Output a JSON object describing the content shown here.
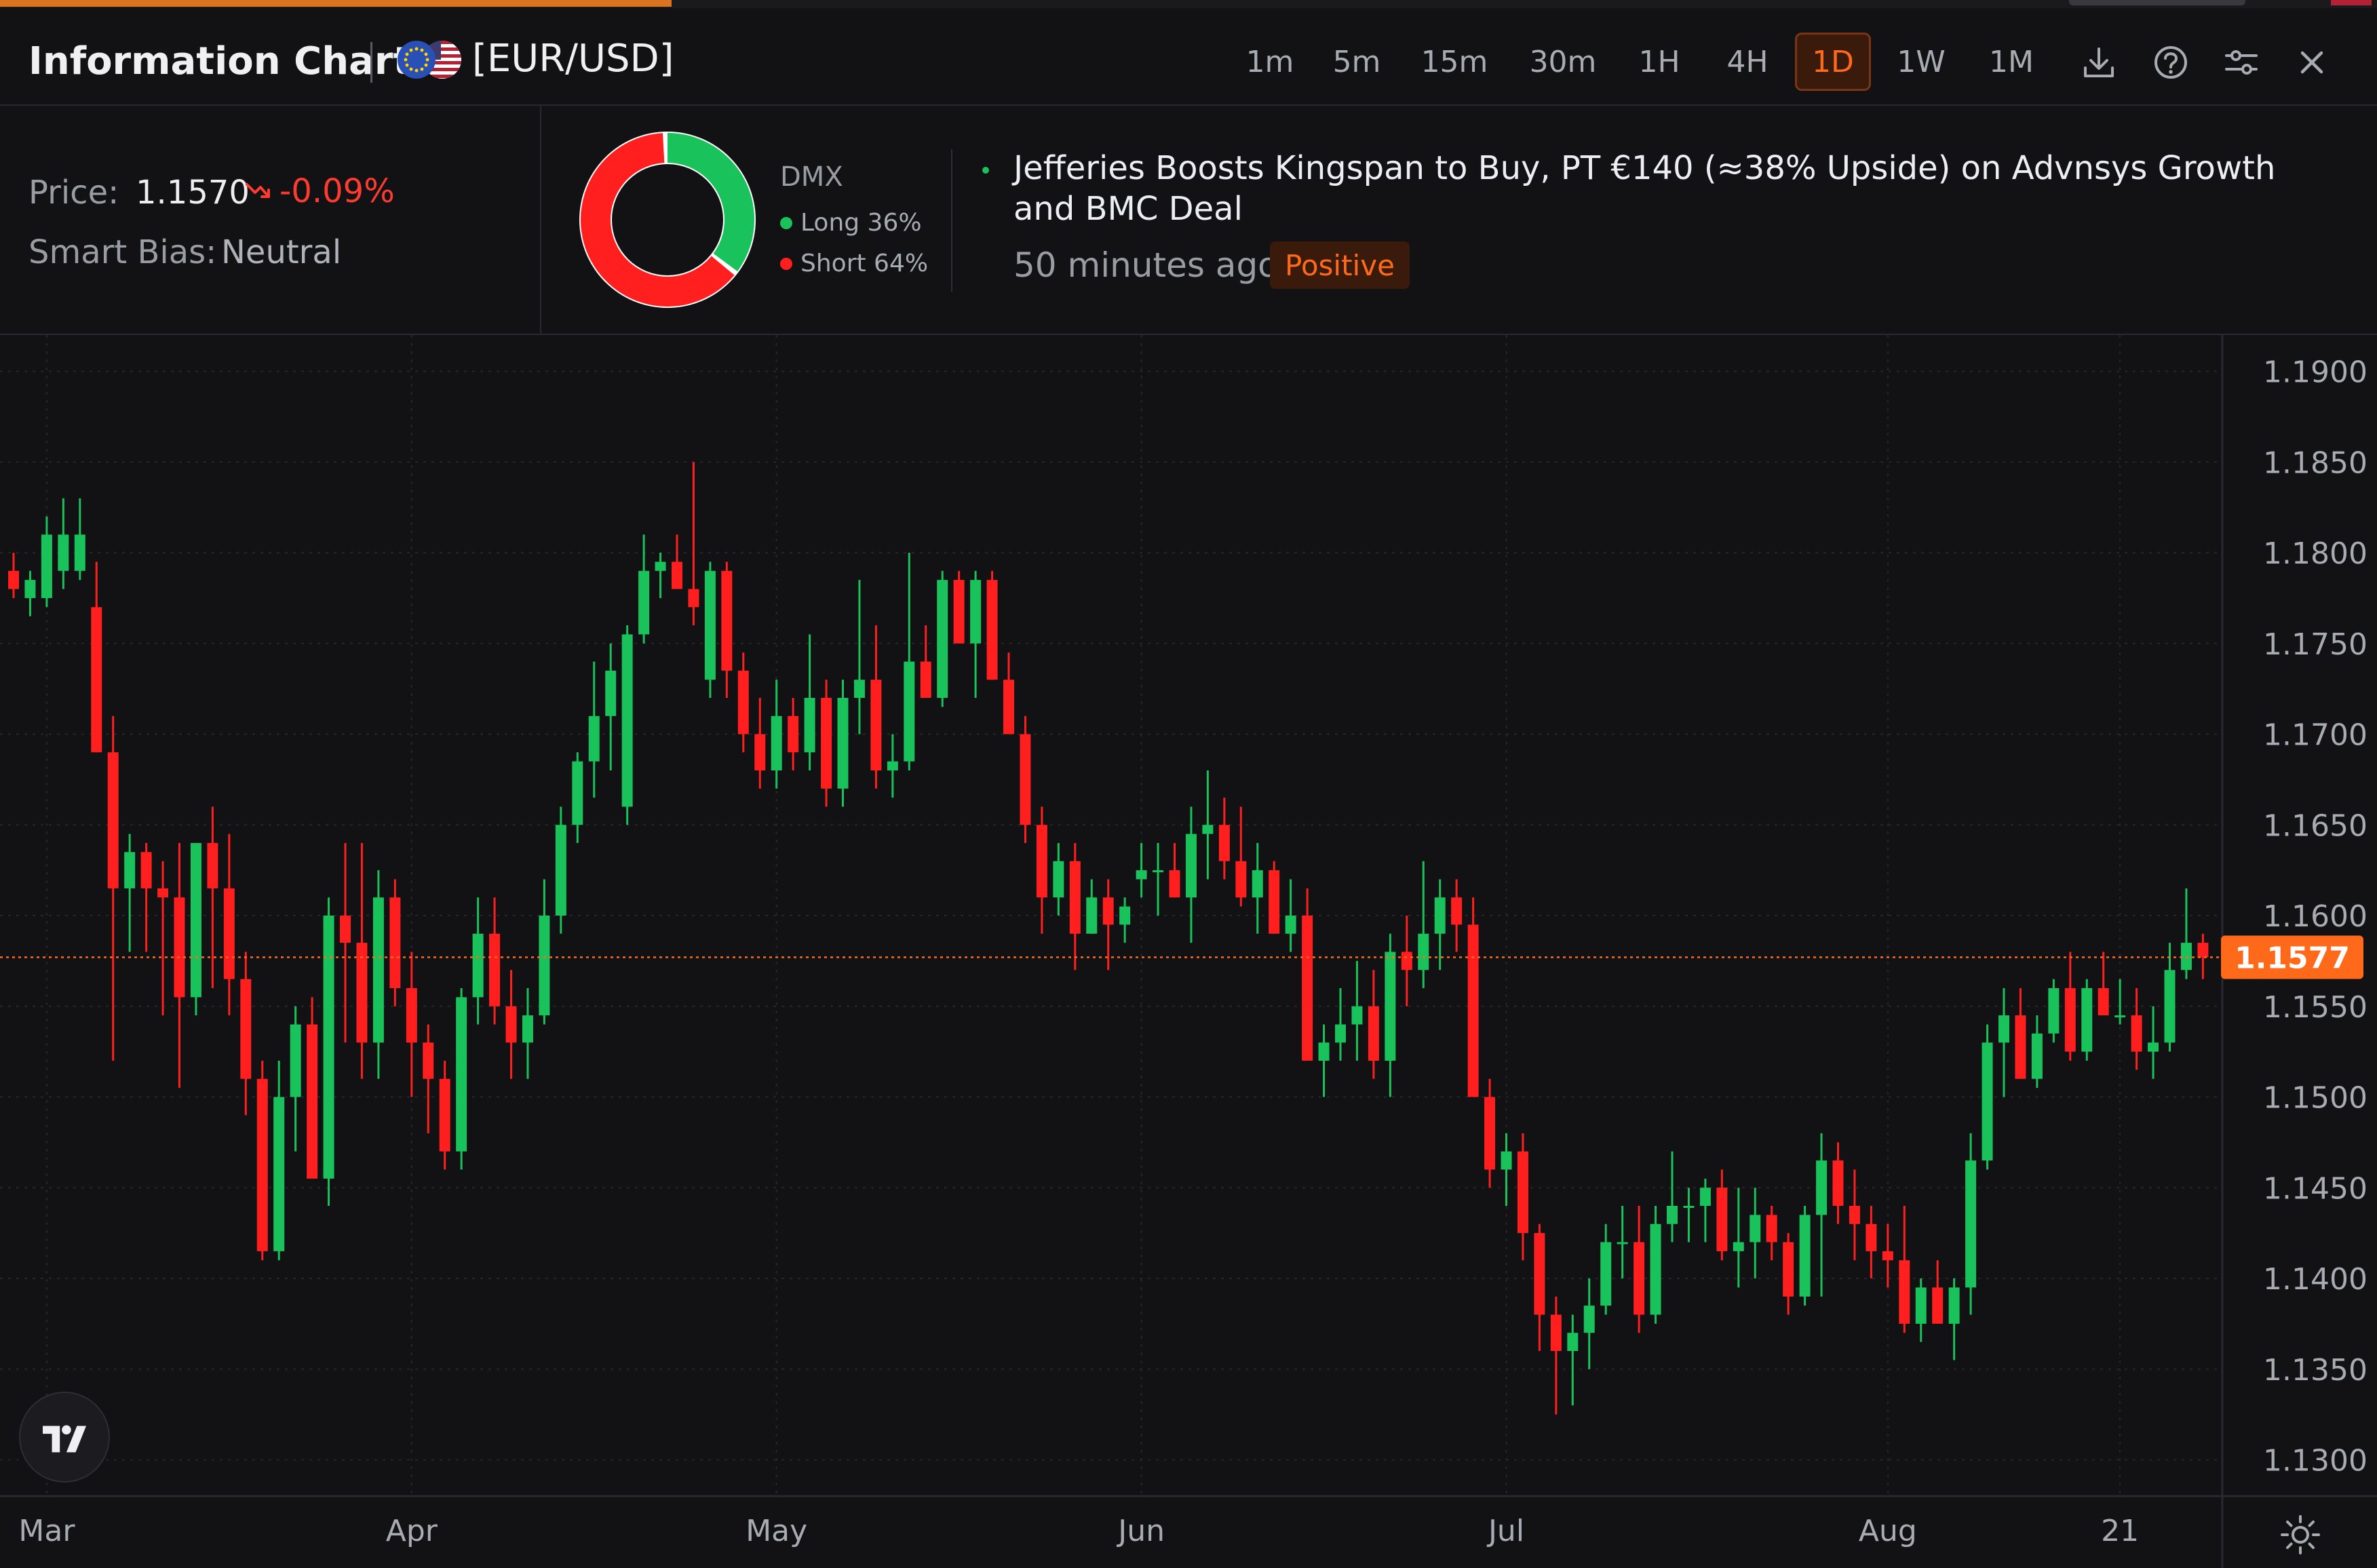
{
  "header": {
    "title": "Information Chart",
    "symbol": "[EUR/USD]",
    "timeframes": [
      {
        "label": "1m",
        "active": false
      },
      {
        "label": "5m",
        "active": false
      },
      {
        "label": "15m",
        "active": false
      },
      {
        "label": "30m",
        "active": false
      },
      {
        "label": "1H",
        "active": false
      },
      {
        "label": "4H",
        "active": false
      },
      {
        "label": "1D",
        "active": true
      },
      {
        "label": "1W",
        "active": false
      },
      {
        "label": "1M",
        "active": false
      }
    ],
    "tools": [
      "download-icon",
      "help-icon",
      "settings-sliders-icon",
      "close-icon"
    ]
  },
  "info": {
    "price_label": "Price:",
    "price_value": "1.1570",
    "price_change": "-0.09%",
    "bias_label": "Smart Bias:",
    "bias_value": "Neutral",
    "dmx_label": "DMX",
    "long_label": "Long 36%",
    "short_label": "Short 64%",
    "long_pct": 36,
    "short_pct": 64
  },
  "news": {
    "title": "Jefferies Boosts Kingspan to Buy, PT €140 (≈38% Upside) on Advnsys Growth and BMC Deal",
    "time": "50 minutes ago",
    "sentiment": "Positive"
  },
  "colors": {
    "up": "#19c25b",
    "down": "#ff1f1f",
    "accent": "#ff6a1a",
    "background": "#121214"
  },
  "chart_data": {
    "type": "candlestick",
    "ylim": [
      1.128,
      1.192
    ],
    "y_ticks": [
      "1.1900",
      "1.1850",
      "1.1800",
      "1.1750",
      "1.1700",
      "1.1650",
      "1.1600",
      "1.1550",
      "1.1500",
      "1.1450",
      "1.1400",
      "1.1350",
      "1.1300"
    ],
    "x_ticks": [
      {
        "label": "Mar",
        "index": 2
      },
      {
        "label": "Apr",
        "index": 24
      },
      {
        "label": "May",
        "index": 46
      },
      {
        "label": "Jun",
        "index": 68
      },
      {
        "label": "Jul",
        "index": 90
      },
      {
        "label": "Aug",
        "index": 113
      },
      {
        "label": "21",
        "index": 127
      }
    ],
    "current_price": "1.1577",
    "candles": [
      {
        "o": 1.179,
        "h": 1.18,
        "l": 1.1775,
        "c": 1.178
      },
      {
        "o": 1.1775,
        "h": 1.179,
        "l": 1.1765,
        "c": 1.1785
      },
      {
        "o": 1.1775,
        "h": 1.182,
        "l": 1.177,
        "c": 1.181
      },
      {
        "o": 1.179,
        "h": 1.183,
        "l": 1.178,
        "c": 1.181
      },
      {
        "o": 1.179,
        "h": 1.183,
        "l": 1.1785,
        "c": 1.181
      },
      {
        "o": 1.177,
        "h": 1.1795,
        "l": 1.169,
        "c": 1.169
      },
      {
        "o": 1.169,
        "h": 1.171,
        "l": 1.152,
        "c": 1.1615
      },
      {
        "o": 1.1615,
        "h": 1.1645,
        "l": 1.158,
        "c": 1.1635
      },
      {
        "o": 1.1635,
        "h": 1.164,
        "l": 1.158,
        "c": 1.1615
      },
      {
        "o": 1.1615,
        "h": 1.163,
        "l": 1.1545,
        "c": 1.161
      },
      {
        "o": 1.161,
        "h": 1.164,
        "l": 1.1505,
        "c": 1.1555
      },
      {
        "o": 1.1555,
        "h": 1.164,
        "l": 1.1545,
        "c": 1.164
      },
      {
        "o": 1.164,
        "h": 1.166,
        "l": 1.156,
        "c": 1.1615
      },
      {
        "o": 1.1615,
        "h": 1.1645,
        "l": 1.1545,
        "c": 1.1565
      },
      {
        "o": 1.1565,
        "h": 1.158,
        "l": 1.149,
        "c": 1.151
      },
      {
        "o": 1.151,
        "h": 1.152,
        "l": 1.141,
        "c": 1.1415
      },
      {
        "o": 1.1415,
        "h": 1.152,
        "l": 1.141,
        "c": 1.15
      },
      {
        "o": 1.15,
        "h": 1.155,
        "l": 1.147,
        "c": 1.154
      },
      {
        "o": 1.154,
        "h": 1.1555,
        "l": 1.146,
        "c": 1.1455
      },
      {
        "o": 1.1455,
        "h": 1.161,
        "l": 1.144,
        "c": 1.16
      },
      {
        "o": 1.16,
        "h": 1.164,
        "l": 1.153,
        "c": 1.1585
      },
      {
        "o": 1.1585,
        "h": 1.164,
        "l": 1.151,
        "c": 1.153
      },
      {
        "o": 1.153,
        "h": 1.1625,
        "l": 1.151,
        "c": 1.161
      },
      {
        "o": 1.161,
        "h": 1.162,
        "l": 1.155,
        "c": 1.156
      },
      {
        "o": 1.156,
        "h": 1.158,
        "l": 1.15,
        "c": 1.153
      },
      {
        "o": 1.153,
        "h": 1.154,
        "l": 1.148,
        "c": 1.151
      },
      {
        "o": 1.151,
        "h": 1.152,
        "l": 1.146,
        "c": 1.147
      },
      {
        "o": 1.147,
        "h": 1.156,
        "l": 1.146,
        "c": 1.1555
      },
      {
        "o": 1.1555,
        "h": 1.161,
        "l": 1.154,
        "c": 1.159
      },
      {
        "o": 1.159,
        "h": 1.161,
        "l": 1.154,
        "c": 1.155
      },
      {
        "o": 1.155,
        "h": 1.157,
        "l": 1.151,
        "c": 1.153
      },
      {
        "o": 1.153,
        "h": 1.156,
        "l": 1.151,
        "c": 1.1545
      },
      {
        "o": 1.1545,
        "h": 1.162,
        "l": 1.154,
        "c": 1.16
      },
      {
        "o": 1.16,
        "h": 1.166,
        "l": 1.159,
        "c": 1.165
      },
      {
        "o": 1.165,
        "h": 1.169,
        "l": 1.164,
        "c": 1.1685
      },
      {
        "o": 1.1685,
        "h": 1.174,
        "l": 1.1665,
        "c": 1.171
      },
      {
        "o": 1.171,
        "h": 1.175,
        "l": 1.168,
        "c": 1.1735
      },
      {
        "o": 1.166,
        "h": 1.176,
        "l": 1.165,
        "c": 1.1755
      },
      {
        "o": 1.1755,
        "h": 1.181,
        "l": 1.175,
        "c": 1.179
      },
      {
        "o": 1.179,
        "h": 1.18,
        "l": 1.1775,
        "c": 1.1795
      },
      {
        "o": 1.1795,
        "h": 1.181,
        "l": 1.178,
        "c": 1.178
      },
      {
        "o": 1.178,
        "h": 1.185,
        "l": 1.176,
        "c": 1.177
      },
      {
        "o": 1.173,
        "h": 1.1795,
        "l": 1.172,
        "c": 1.179
      },
      {
        "o": 1.179,
        "h": 1.1795,
        "l": 1.172,
        "c": 1.1735
      },
      {
        "o": 1.1735,
        "h": 1.1745,
        "l": 1.169,
        "c": 1.17
      },
      {
        "o": 1.17,
        "h": 1.172,
        "l": 1.167,
        "c": 1.168
      },
      {
        "o": 1.168,
        "h": 1.173,
        "l": 1.167,
        "c": 1.171
      },
      {
        "o": 1.171,
        "h": 1.172,
        "l": 1.168,
        "c": 1.169
      },
      {
        "o": 1.169,
        "h": 1.1755,
        "l": 1.168,
        "c": 1.172
      },
      {
        "o": 1.172,
        "h": 1.173,
        "l": 1.166,
        "c": 1.167
      },
      {
        "o": 1.167,
        "h": 1.173,
        "l": 1.166,
        "c": 1.172
      },
      {
        "o": 1.172,
        "h": 1.1785,
        "l": 1.17,
        "c": 1.173
      },
      {
        "o": 1.173,
        "h": 1.176,
        "l": 1.167,
        "c": 1.168
      },
      {
        "o": 1.168,
        "h": 1.17,
        "l": 1.1665,
        "c": 1.1685
      },
      {
        "o": 1.1685,
        "h": 1.18,
        "l": 1.168,
        "c": 1.174
      },
      {
        "o": 1.174,
        "h": 1.176,
        "l": 1.172,
        "c": 1.172
      },
      {
        "o": 1.172,
        "h": 1.179,
        "l": 1.1715,
        "c": 1.1785
      },
      {
        "o": 1.1785,
        "h": 1.179,
        "l": 1.175,
        "c": 1.175
      },
      {
        "o": 1.175,
        "h": 1.179,
        "l": 1.172,
        "c": 1.1785
      },
      {
        "o": 1.1785,
        "h": 1.179,
        "l": 1.173,
        "c": 1.173
      },
      {
        "o": 1.173,
        "h": 1.1745,
        "l": 1.17,
        "c": 1.17
      },
      {
        "o": 1.17,
        "h": 1.171,
        "l": 1.164,
        "c": 1.165
      },
      {
        "o": 1.165,
        "h": 1.166,
        "l": 1.159,
        "c": 1.161
      },
      {
        "o": 1.161,
        "h": 1.164,
        "l": 1.16,
        "c": 1.163
      },
      {
        "o": 1.163,
        "h": 1.164,
        "l": 1.157,
        "c": 1.159
      },
      {
        "o": 1.159,
        "h": 1.162,
        "l": 1.159,
        "c": 1.161
      },
      {
        "o": 1.161,
        "h": 1.162,
        "l": 1.157,
        "c": 1.1595
      },
      {
        "o": 1.1595,
        "h": 1.161,
        "l": 1.1585,
        "c": 1.1605
      },
      {
        "o": 1.162,
        "h": 1.164,
        "l": 1.161,
        "c": 1.1625
      },
      {
        "o": 1.1625,
        "h": 1.164,
        "l": 1.16,
        "c": 1.1625
      },
      {
        "o": 1.1625,
        "h": 1.164,
        "l": 1.161,
        "c": 1.161
      },
      {
        "o": 1.161,
        "h": 1.166,
        "l": 1.1585,
        "c": 1.1645
      },
      {
        "o": 1.1645,
        "h": 1.168,
        "l": 1.162,
        "c": 1.165
      },
      {
        "o": 1.165,
        "h": 1.1665,
        "l": 1.162,
        "c": 1.163
      },
      {
        "o": 1.163,
        "h": 1.166,
        "l": 1.1605,
        "c": 1.161
      },
      {
        "o": 1.161,
        "h": 1.164,
        "l": 1.159,
        "c": 1.1625
      },
      {
        "o": 1.1625,
        "h": 1.163,
        "l": 1.159,
        "c": 1.159
      },
      {
        "o": 1.159,
        "h": 1.162,
        "l": 1.158,
        "c": 1.16
      },
      {
        "o": 1.16,
        "h": 1.1615,
        "l": 1.152,
        "c": 1.152
      },
      {
        "o": 1.152,
        "h": 1.154,
        "l": 1.15,
        "c": 1.153
      },
      {
        "o": 1.153,
        "h": 1.156,
        "l": 1.152,
        "c": 1.154
      },
      {
        "o": 1.154,
        "h": 1.1575,
        "l": 1.152,
        "c": 1.155
      },
      {
        "o": 1.155,
        "h": 1.157,
        "l": 1.151,
        "c": 1.152
      },
      {
        "o": 1.152,
        "h": 1.159,
        "l": 1.15,
        "c": 1.158
      },
      {
        "o": 1.158,
        "h": 1.16,
        "l": 1.155,
        "c": 1.157
      },
      {
        "o": 1.157,
        "h": 1.163,
        "l": 1.156,
        "c": 1.159
      },
      {
        "o": 1.159,
        "h": 1.162,
        "l": 1.157,
        "c": 1.161
      },
      {
        "o": 1.161,
        "h": 1.162,
        "l": 1.158,
        "c": 1.1595
      },
      {
        "o": 1.1595,
        "h": 1.161,
        "l": 1.15,
        "c": 1.15
      },
      {
        "o": 1.15,
        "h": 1.151,
        "l": 1.145,
        "c": 1.146
      },
      {
        "o": 1.146,
        "h": 1.148,
        "l": 1.144,
        "c": 1.147
      },
      {
        "o": 1.147,
        "h": 1.148,
        "l": 1.141,
        "c": 1.1425
      },
      {
        "o": 1.1425,
        "h": 1.143,
        "l": 1.136,
        "c": 1.138
      },
      {
        "o": 1.138,
        "h": 1.139,
        "l": 1.1325,
        "c": 1.136
      },
      {
        "o": 1.136,
        "h": 1.138,
        "l": 1.133,
        "c": 1.137
      },
      {
        "o": 1.137,
        "h": 1.14,
        "l": 1.135,
        "c": 1.1385
      },
      {
        "o": 1.1385,
        "h": 1.143,
        "l": 1.138,
        "c": 1.142
      },
      {
        "o": 1.142,
        "h": 1.144,
        "l": 1.14,
        "c": 1.142
      },
      {
        "o": 1.142,
        "h": 1.144,
        "l": 1.137,
        "c": 1.138
      },
      {
        "o": 1.138,
        "h": 1.144,
        "l": 1.1375,
        "c": 1.143
      },
      {
        "o": 1.143,
        "h": 1.147,
        "l": 1.142,
        "c": 1.144
      },
      {
        "o": 1.144,
        "h": 1.145,
        "l": 1.142,
        "c": 1.144
      },
      {
        "o": 1.144,
        "h": 1.1455,
        "l": 1.142,
        "c": 1.145
      },
      {
        "o": 1.145,
        "h": 1.146,
        "l": 1.141,
        "c": 1.1415
      },
      {
        "o": 1.1415,
        "h": 1.145,
        "l": 1.1395,
        "c": 1.142
      },
      {
        "o": 1.142,
        "h": 1.145,
        "l": 1.14,
        "c": 1.1435
      },
      {
        "o": 1.1435,
        "h": 1.144,
        "l": 1.141,
        "c": 1.142
      },
      {
        "o": 1.142,
        "h": 1.1425,
        "l": 1.138,
        "c": 1.139
      },
      {
        "o": 1.139,
        "h": 1.144,
        "l": 1.1385,
        "c": 1.1435
      },
      {
        "o": 1.1435,
        "h": 1.148,
        "l": 1.139,
        "c": 1.1465
      },
      {
        "o": 1.1465,
        "h": 1.1475,
        "l": 1.143,
        "c": 1.144
      },
      {
        "o": 1.144,
        "h": 1.146,
        "l": 1.141,
        "c": 1.143
      },
      {
        "o": 1.143,
        "h": 1.144,
        "l": 1.14,
        "c": 1.1415
      },
      {
        "o": 1.1415,
        "h": 1.143,
        "l": 1.1395,
        "c": 1.141
      },
      {
        "o": 1.141,
        "h": 1.144,
        "l": 1.137,
        "c": 1.1375
      },
      {
        "o": 1.1375,
        "h": 1.14,
        "l": 1.1365,
        "c": 1.1395
      },
      {
        "o": 1.1395,
        "h": 1.141,
        "l": 1.138,
        "c": 1.1375
      },
      {
        "o": 1.1375,
        "h": 1.14,
        "l": 1.1355,
        "c": 1.1395
      },
      {
        "o": 1.1395,
        "h": 1.148,
        "l": 1.138,
        "c": 1.1465
      },
      {
        "o": 1.1465,
        "h": 1.154,
        "l": 1.146,
        "c": 1.153
      },
      {
        "o": 1.153,
        "h": 1.156,
        "l": 1.15,
        "c": 1.1545
      },
      {
        "o": 1.1545,
        "h": 1.156,
        "l": 1.151,
        "c": 1.151
      },
      {
        "o": 1.151,
        "h": 1.1545,
        "l": 1.1505,
        "c": 1.1535
      },
      {
        "o": 1.1535,
        "h": 1.1565,
        "l": 1.153,
        "c": 1.156
      },
      {
        "o": 1.156,
        "h": 1.158,
        "l": 1.152,
        "c": 1.1525
      },
      {
        "o": 1.1525,
        "h": 1.1565,
        "l": 1.152,
        "c": 1.156
      },
      {
        "o": 1.156,
        "h": 1.158,
        "l": 1.155,
        "c": 1.1545
      },
      {
        "o": 1.1545,
        "h": 1.1565,
        "l": 1.154,
        "c": 1.1545
      },
      {
        "o": 1.1545,
        "h": 1.156,
        "l": 1.1515,
        "c": 1.1525
      },
      {
        "o": 1.1525,
        "h": 1.155,
        "l": 1.151,
        "c": 1.153
      },
      {
        "o": 1.153,
        "h": 1.1585,
        "l": 1.1525,
        "c": 1.157
      },
      {
        "o": 1.157,
        "h": 1.1615,
        "l": 1.1565,
        "c": 1.1585
      },
      {
        "o": 1.1585,
        "h": 1.159,
        "l": 1.1565,
        "c": 1.1577
      }
    ]
  }
}
